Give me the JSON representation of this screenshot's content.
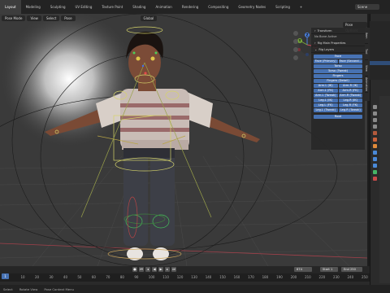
{
  "workspace_tabs": [
    "Layout",
    "Modeling",
    "Sculpting",
    "UV Editing",
    "Texture Paint",
    "Shading",
    "Animation",
    "Rendering",
    "Compositing",
    "Geometry Nodes",
    "Scripting",
    "+"
  ],
  "scene_label": "Scene",
  "viewport": {
    "mode": "Pose Mode",
    "view": "View",
    "select": "Select",
    "pose": "Pose",
    "transform_orientation": "Global",
    "pose_options": "Pose Options"
  },
  "gizmo": {
    "x": "X",
    "y": "Y",
    "z": "Z"
  },
  "npanel": {
    "transform_header": "Transform",
    "no_active": "No Bone Active",
    "rig_main_header": "Rig Main Properties",
    "rig_layers_header": "Rig Layers",
    "layers": [
      [
        "Face"
      ],
      [
        "Face (Primary)",
        "Face (Second..."
      ],
      [
        "Torso"
      ],
      [
        "Torso (Tweak)"
      ],
      [
        "Fingers"
      ],
      [
        "Fingers (Detail)"
      ],
      [
        "Arm.L (IK)",
        "Arm.R (IK)"
      ],
      [
        "Arm.L (FK)",
        "Arm.R (FK)"
      ],
      [
        "Arm.L (Tweak)",
        "Arm.R (Tweak)"
      ],
      [
        "Leg.L (IK)",
        "Leg.R (IK)"
      ],
      [
        "Leg.L (FK)",
        "Leg.R (FK)"
      ],
      [
        "Leg.L (Tweak)",
        "Leg.R (Tweak)"
      ],
      [
        "Root"
      ]
    ]
  },
  "side_tabs": [
    "Item",
    "Tool",
    "View",
    "Animation",
    "UVAP"
  ],
  "timeline": {
    "current_frame": "1",
    "frame_current_box": "674",
    "start_label": "Start",
    "start_value": "1",
    "end_label": "End",
    "end_value": "250",
    "ticks": [
      "0",
      "10",
      "20",
      "30",
      "40",
      "50",
      "60",
      "70",
      "80",
      "90",
      "100",
      "110",
      "120",
      "130",
      "140",
      "150",
      "160",
      "170",
      "180",
      "190",
      "200",
      "210",
      "220",
      "230",
      "240",
      "250"
    ]
  },
  "status": {
    "select": "Select",
    "rotate_view": "Rotate View",
    "context_menu": "Pose Context Menu"
  },
  "colors": {
    "accent": "#4772b3",
    "viewport_bg": "#3a3a3a",
    "panel_bg": "#282828"
  }
}
